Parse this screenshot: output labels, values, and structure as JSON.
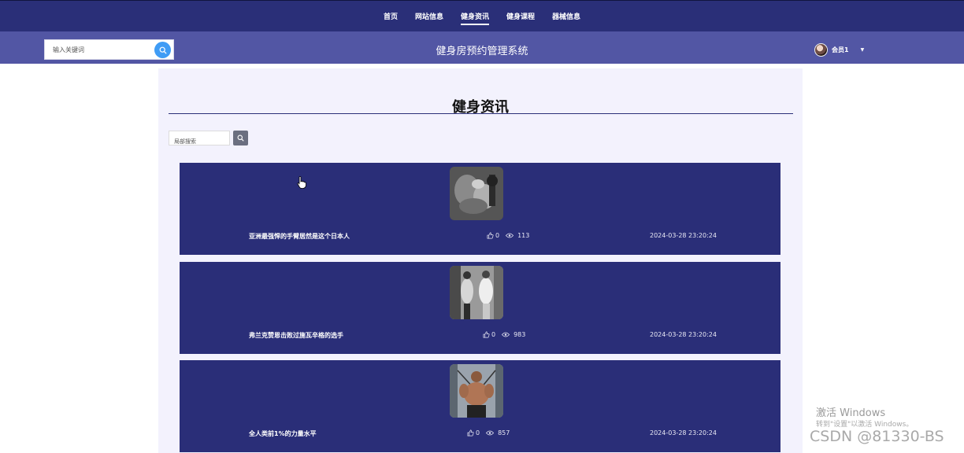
{
  "nav": {
    "items": [
      {
        "label": "首页",
        "active": false
      },
      {
        "label": "网站信息",
        "active": false
      },
      {
        "label": "健身资讯",
        "active": true
      },
      {
        "label": "健身课程",
        "active": false
      },
      {
        "label": "器械信息",
        "active": false
      }
    ]
  },
  "header": {
    "search_placeholder": "输入关键词",
    "site_title": "健身房预约管理系统",
    "user_name": "会员1",
    "caret": "▼"
  },
  "main": {
    "page_title": "健身资讯",
    "local_search_placeholder": "局部搜索"
  },
  "news": [
    {
      "title": "亚洲最强悍的手臂居然是这个日本人",
      "likes": "0",
      "views": "113",
      "date": "2024-03-28 23:20:24",
      "thumb": "arm-curl-photo"
    },
    {
      "title": "弗兰克赞恩击败过施瓦辛格的选手",
      "likes": "0",
      "views": "983",
      "date": "2024-03-28 23:20:24",
      "thumb": "gym-posing-photo"
    },
    {
      "title": "全人类前1%的力量水平",
      "likes": "0",
      "views": "857",
      "date": "2024-03-28 23:20:24",
      "thumb": "cable-machine-photo"
    }
  ],
  "watermarks": {
    "activate_title": "激活 Windows",
    "activate_sub": "转到\"设置\"以激活 Windows。",
    "csdn": "CSDN @81330-BS"
  },
  "colors": {
    "nav_bg": "#2a2f78",
    "header_bg": "#5256a4",
    "card_bg": "#2a2e78",
    "panel_bg": "#f3f2fd",
    "search_btn": "#3f9cf5"
  }
}
